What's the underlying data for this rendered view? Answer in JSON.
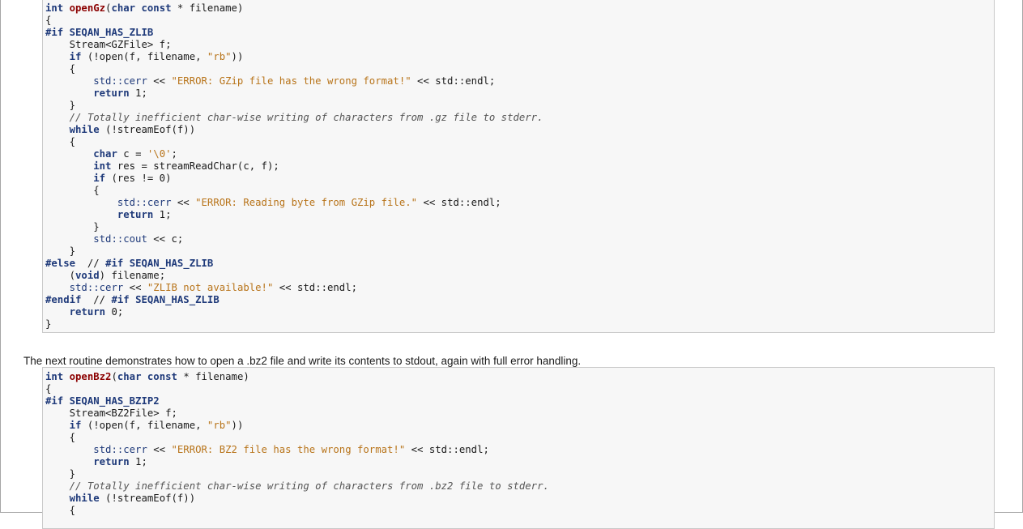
{
  "paragraph": "The next routine demonstrates how to open a .bz2 file and write its contents to stdout, again with full error handling.",
  "code_blocks": [
    {
      "lines": [
        [
          [
            "kw",
            "int"
          ],
          [
            "plain",
            " "
          ],
          [
            "fn",
            "openGz"
          ],
          [
            "plain",
            "("
          ],
          [
            "kw",
            "char"
          ],
          [
            "plain",
            " "
          ],
          [
            "kw",
            "const"
          ],
          [
            "plain",
            " * filename)"
          ]
        ],
        [
          [
            "plain",
            "{"
          ]
        ],
        [
          [
            "pp",
            "#if"
          ],
          [
            "plain",
            " "
          ],
          [
            "pp",
            "SEQAN_HAS_ZLIB"
          ]
        ],
        [
          [
            "plain",
            "    Stream<GZFile> f;"
          ]
        ],
        [
          [
            "plain",
            "    "
          ],
          [
            "kw",
            "if"
          ],
          [
            "plain",
            " (!open(f, filename, "
          ],
          [
            "str",
            "\"rb\""
          ],
          [
            "plain",
            "))"
          ]
        ],
        [
          [
            "plain",
            "    {"
          ]
        ],
        [
          [
            "plain",
            "        "
          ],
          [
            "ns",
            "std::cerr"
          ],
          [
            "plain",
            " << "
          ],
          [
            "str",
            "\"ERROR: GZip file has the wrong format!\""
          ],
          [
            "plain",
            " << std::endl;"
          ]
        ],
        [
          [
            "plain",
            "        "
          ],
          [
            "kw",
            "return"
          ],
          [
            "plain",
            " 1;"
          ]
        ],
        [
          [
            "plain",
            "    }"
          ]
        ],
        [
          [
            "plain",
            "    "
          ],
          [
            "cmt",
            "// Totally inefficient char-wise writing of characters from .gz file to stderr."
          ]
        ],
        [
          [
            "plain",
            "    "
          ],
          [
            "kw",
            "while"
          ],
          [
            "plain",
            " (!streamEof(f))"
          ]
        ],
        [
          [
            "plain",
            "    {"
          ]
        ],
        [
          [
            "plain",
            "        "
          ],
          [
            "kw",
            "char"
          ],
          [
            "plain",
            " c = "
          ],
          [
            "str",
            "'\\0'"
          ],
          [
            "plain",
            ";"
          ]
        ],
        [
          [
            "plain",
            "        "
          ],
          [
            "kw",
            "int"
          ],
          [
            "plain",
            " res = streamReadChar(c, f);"
          ]
        ],
        [
          [
            "plain",
            "        "
          ],
          [
            "kw",
            "if"
          ],
          [
            "plain",
            " (res != 0)"
          ]
        ],
        [
          [
            "plain",
            "        {"
          ]
        ],
        [
          [
            "plain",
            "            "
          ],
          [
            "ns",
            "std::cerr"
          ],
          [
            "plain",
            " << "
          ],
          [
            "str",
            "\"ERROR: Reading byte from GZip file.\""
          ],
          [
            "plain",
            " << std::endl;"
          ]
        ],
        [
          [
            "plain",
            "            "
          ],
          [
            "kw",
            "return"
          ],
          [
            "plain",
            " 1;"
          ]
        ],
        [
          [
            "plain",
            "        }"
          ]
        ],
        [
          [
            "plain",
            "        "
          ],
          [
            "ns",
            "std::cout"
          ],
          [
            "plain",
            " << c;"
          ]
        ],
        [
          [
            "plain",
            "    }"
          ]
        ],
        [
          [
            "pp",
            "#else"
          ],
          [
            "plain",
            "  // "
          ],
          [
            "pp",
            "#if"
          ],
          [
            "plain",
            " "
          ],
          [
            "pp",
            "SEQAN_HAS_ZLIB"
          ]
        ],
        [
          [
            "plain",
            "    ("
          ],
          [
            "kw",
            "void"
          ],
          [
            "plain",
            ") filename;"
          ]
        ],
        [
          [
            "plain",
            "    "
          ],
          [
            "ns",
            "std::cerr"
          ],
          [
            "plain",
            " << "
          ],
          [
            "str",
            "\"ZLIB not available!\""
          ],
          [
            "plain",
            " << std::endl;"
          ]
        ],
        [
          [
            "pp",
            "#endif"
          ],
          [
            "plain",
            "  // "
          ],
          [
            "pp",
            "#if"
          ],
          [
            "plain",
            " "
          ],
          [
            "pp",
            "SEQAN_HAS_ZLIB"
          ]
        ],
        [
          [
            "plain",
            "    "
          ],
          [
            "kw",
            "return"
          ],
          [
            "plain",
            " 0;"
          ]
        ],
        [
          [
            "plain",
            "}"
          ]
        ]
      ]
    },
    {
      "lines": [
        [
          [
            "kw",
            "int"
          ],
          [
            "plain",
            " "
          ],
          [
            "fn",
            "openBz2"
          ],
          [
            "plain",
            "("
          ],
          [
            "kw",
            "char"
          ],
          [
            "plain",
            " "
          ],
          [
            "kw",
            "const"
          ],
          [
            "plain",
            " * filename)"
          ]
        ],
        [
          [
            "plain",
            "{"
          ]
        ],
        [
          [
            "pp",
            "#if"
          ],
          [
            "plain",
            " "
          ],
          [
            "pp",
            "SEQAN_HAS_BZIP2"
          ]
        ],
        [
          [
            "plain",
            "    Stream<BZ2File> f;"
          ]
        ],
        [
          [
            "plain",
            "    "
          ],
          [
            "kw",
            "if"
          ],
          [
            "plain",
            " (!open(f, filename, "
          ],
          [
            "str",
            "\"rb\""
          ],
          [
            "plain",
            "))"
          ]
        ],
        [
          [
            "plain",
            "    {"
          ]
        ],
        [
          [
            "plain",
            "        "
          ],
          [
            "ns",
            "std::cerr"
          ],
          [
            "plain",
            " << "
          ],
          [
            "str",
            "\"ERROR: BZ2 file has the wrong format!\""
          ],
          [
            "plain",
            " << std::endl;"
          ]
        ],
        [
          [
            "plain",
            "        "
          ],
          [
            "kw",
            "return"
          ],
          [
            "plain",
            " 1;"
          ]
        ],
        [
          [
            "plain",
            "    }"
          ]
        ],
        [
          [
            "plain",
            "    "
          ],
          [
            "cmt",
            "// Totally inefficient char-wise writing of characters from .bz2 file to stderr."
          ]
        ],
        [
          [
            "plain",
            "    "
          ],
          [
            "kw",
            "while"
          ],
          [
            "plain",
            " (!streamEof(f))"
          ]
        ],
        [
          [
            "plain",
            "    {"
          ]
        ]
      ]
    }
  ]
}
